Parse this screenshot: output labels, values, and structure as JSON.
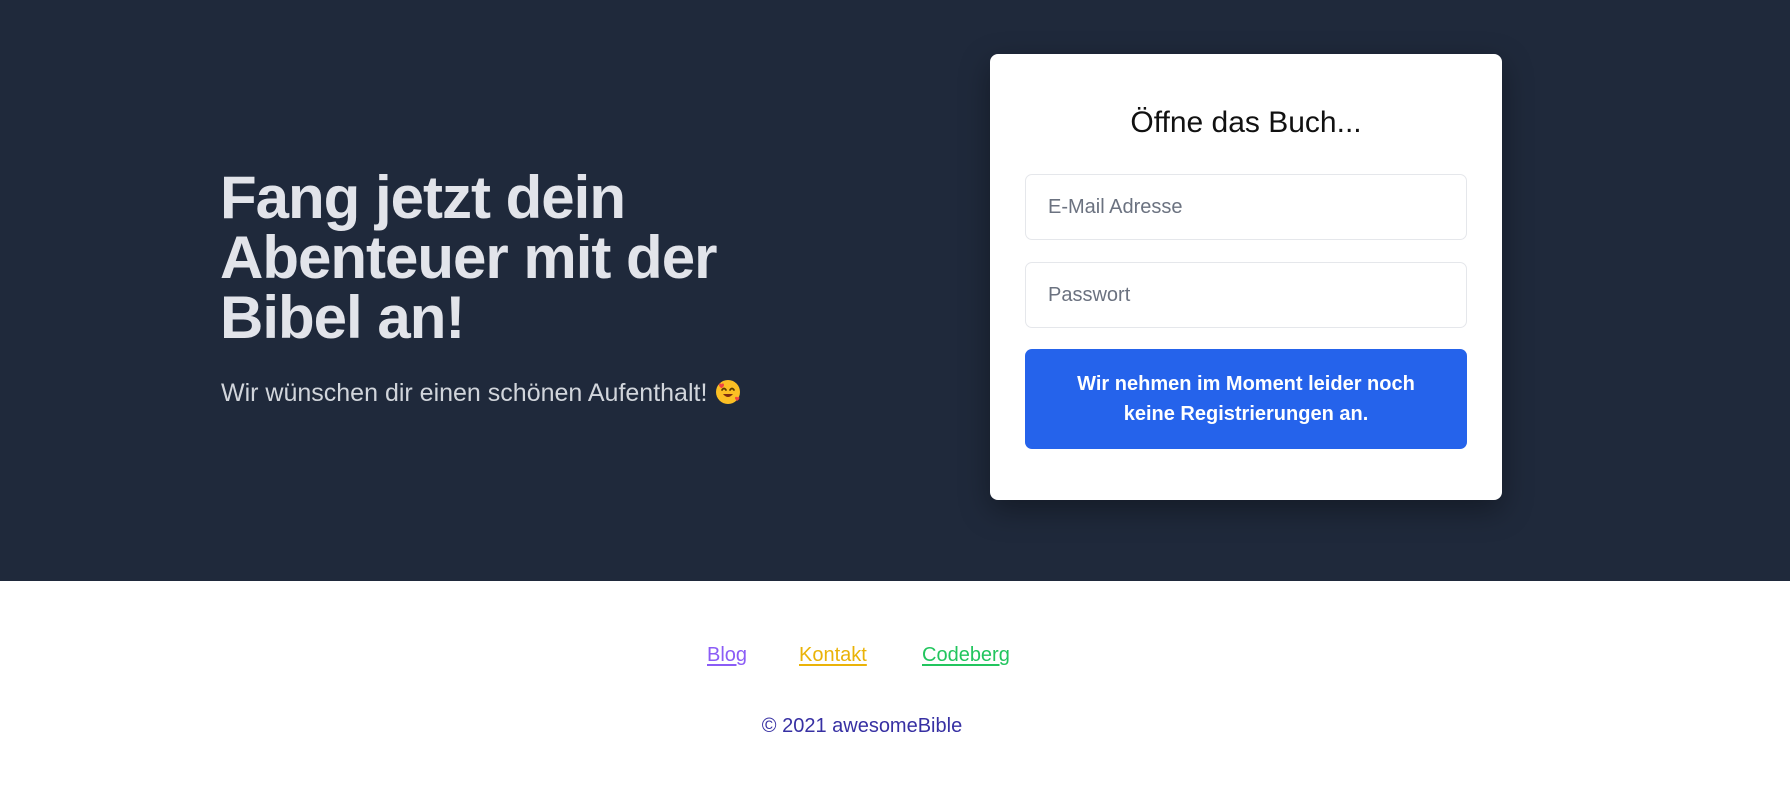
{
  "hero": {
    "title": "Fang jetzt dein Abenteuer mit der Bibel an!",
    "subtitle": "Wir wünschen dir einen schönen Aufenthalt!",
    "emoji_icon": "smiling-face-with-hearts-icon"
  },
  "login_card": {
    "heading": "Öffne das Buch...",
    "email_placeholder": "E-Mail Adresse",
    "password_placeholder": "Passwort",
    "submit_label": "Wir nehmen im Moment leider noch keine Registrierungen an."
  },
  "footer": {
    "links": [
      {
        "label": "Blog",
        "color": "#8b5cf6"
      },
      {
        "label": "Kontakt",
        "color": "#eab308"
      },
      {
        "label": "Codeberg",
        "color": "#22c55e"
      }
    ],
    "copyright": "© 2021 awesomeBible"
  },
  "colors": {
    "hero_background": "#1f293b",
    "button": "#2563eb",
    "copyright": "#3730a3"
  }
}
